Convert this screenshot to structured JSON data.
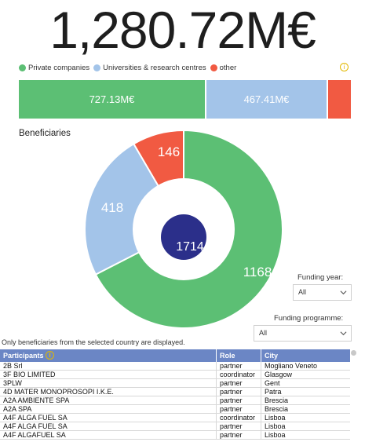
{
  "total": "1,280.72M€",
  "legend": {
    "items": [
      {
        "label": "Private companies",
        "color": "#5cbf74"
      },
      {
        "label": "Universities & research centres",
        "color": "#a3c4e9"
      },
      {
        "label": "other",
        "color": "#f15a42"
      }
    ]
  },
  "funding_bar": {
    "segments": [
      {
        "label": "727.13M€",
        "value": 727.13,
        "color": "#5cbf74"
      },
      {
        "label": "467.41M€",
        "value": 467.41,
        "color": "#a3c4e9"
      },
      {
        "label": "",
        "value": 86.18,
        "color": "#f15a42"
      }
    ]
  },
  "beneficiaries": {
    "title": "Beneficiaries",
    "total": "1714",
    "segments": [
      {
        "label": "1168",
        "value": 1168,
        "color": "#5cbf74"
      },
      {
        "label": "418",
        "value": 418,
        "color": "#a3c4e9"
      },
      {
        "label": "146",
        "value": 146,
        "color": "#f15a42"
      }
    ],
    "center_color": "#2b2f8a"
  },
  "filters": {
    "funding_year": {
      "label": "Funding year:",
      "value": "All"
    },
    "funding_programme": {
      "label": "Funding programme:",
      "value": "All"
    }
  },
  "note": "Only beneficiaries from the selected country are displayed.",
  "table": {
    "headers": [
      "Participants",
      "Role",
      "City"
    ],
    "rows": [
      [
        "2B Srl",
        "partner",
        "Mogliano Veneto"
      ],
      [
        "3F BIO LIMITED",
        "coordinator",
        "Glasgow"
      ],
      [
        "3PLW",
        "partner",
        "Gent"
      ],
      [
        "4D MATER MONOPROSOPI I.K.E.",
        "partner",
        "Patra"
      ],
      [
        "A2A AMBIENTE SPA",
        "partner",
        "Brescia"
      ],
      [
        "A2A SPA",
        "partner",
        "Brescia"
      ],
      [
        "A4F ALGA FUEL SA",
        "coordinator",
        "Lisboa"
      ],
      [
        "A4F ALGA FUEL SA",
        "partner",
        "Lisboa"
      ],
      [
        "A4F ALGAFUEL SA",
        "partner",
        "Lisboa"
      ]
    ]
  }
}
